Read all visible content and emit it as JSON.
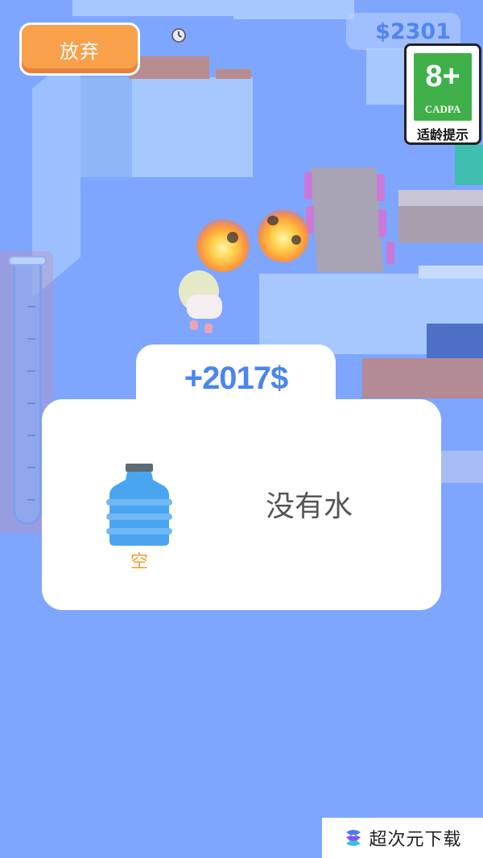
{
  "hud": {
    "give_up_label": "放弃",
    "money": "$2301"
  },
  "age_rating": {
    "rating": "8+",
    "org": "CADPA",
    "tip": "适龄提示"
  },
  "result": {
    "reward": "+2017$",
    "item_icon": "water-bottle-icon",
    "item_status": "空",
    "message": "没有水"
  },
  "watermark": {
    "text": "超次元下载"
  },
  "colors": {
    "background": "#7ea6ff",
    "button_orange": "#f8a04a",
    "reward_blue": "#4a86ee",
    "status_orange": "#f39a2e",
    "rating_green": "#3fb049"
  }
}
